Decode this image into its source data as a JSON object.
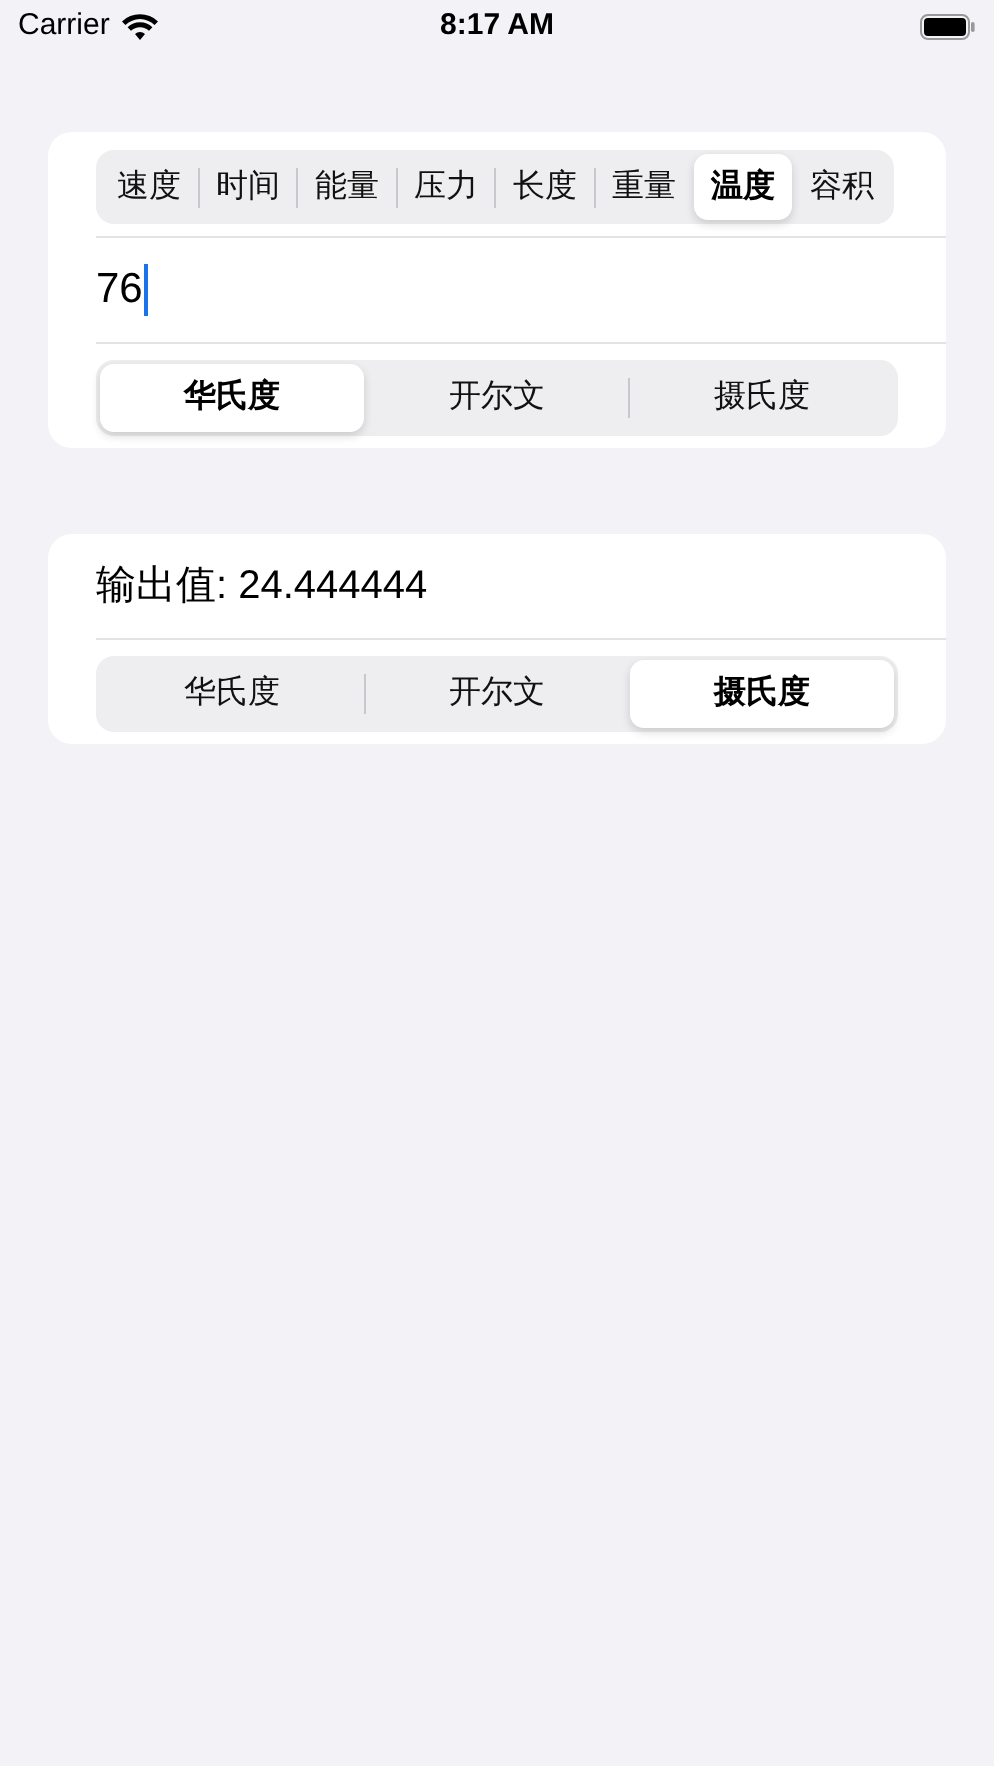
{
  "status_bar": {
    "carrier": "Carrier",
    "time": "8:17 AM"
  },
  "input_card": {
    "categories": [
      {
        "label": "速度",
        "selected": false
      },
      {
        "label": "时间",
        "selected": false
      },
      {
        "label": "能量",
        "selected": false
      },
      {
        "label": "压力",
        "selected": false
      },
      {
        "label": "长度",
        "selected": false
      },
      {
        "label": "重量",
        "selected": false
      },
      {
        "label": "温度",
        "selected": true
      },
      {
        "label": "容积",
        "selected": false
      }
    ],
    "value": "76",
    "units": [
      {
        "label": "华氏度",
        "selected": true
      },
      {
        "label": "开尔文",
        "selected": false
      },
      {
        "label": "摄氏度",
        "selected": false
      }
    ]
  },
  "output_card": {
    "label": "输出值: 24.444444",
    "units": [
      {
        "label": "华氏度",
        "selected": false
      },
      {
        "label": "开尔文",
        "selected": false
      },
      {
        "label": "摄氏度",
        "selected": true
      }
    ]
  }
}
